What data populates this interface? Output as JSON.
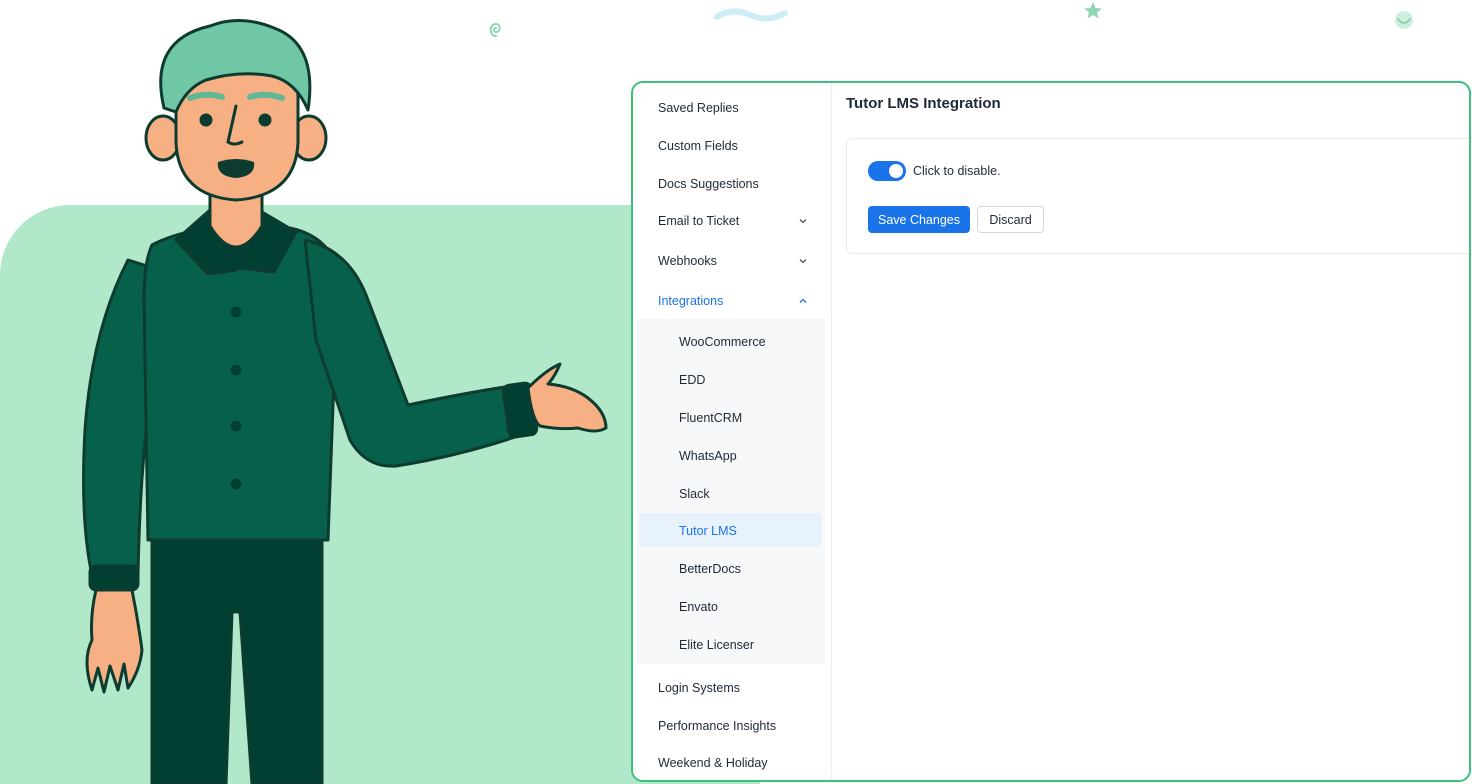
{
  "colors": {
    "accent": "#1a73e8",
    "panel_border": "#3fc07a",
    "background_blob": "#b1e8c9",
    "shirt": "#07614a",
    "pants": "#003f31",
    "hair": "#6fc7a6",
    "skin": "#f7b083"
  },
  "sidebar": {
    "items_top": [
      {
        "label": "Saved Replies"
      },
      {
        "label": "Custom Fields"
      },
      {
        "label": "Docs Suggestions"
      },
      {
        "label": "Email to Ticket",
        "icon": "chevron-down-icon"
      },
      {
        "label": "Webhooks",
        "icon": "chevron-down-icon"
      },
      {
        "label": "Integrations",
        "icon": "chevron-up-icon"
      }
    ],
    "submenu": [
      {
        "label": "WooCommerce"
      },
      {
        "label": "EDD"
      },
      {
        "label": "FluentCRM"
      },
      {
        "label": "WhatsApp"
      },
      {
        "label": "Slack"
      },
      {
        "label": "Tutor LMS"
      },
      {
        "label": "BetterDocs"
      },
      {
        "label": "Envato"
      },
      {
        "label": "Elite Licenser"
      }
    ],
    "items_bottom": [
      {
        "label": "Login Systems"
      },
      {
        "label": "Performance Insights"
      },
      {
        "label": "Weekend & Holiday"
      }
    ]
  },
  "main": {
    "title": "Tutor LMS Integration",
    "toggle": {
      "label": "Click to disable.",
      "state": "on"
    },
    "save_label": "Save Changes",
    "discard_label": "Discard"
  }
}
